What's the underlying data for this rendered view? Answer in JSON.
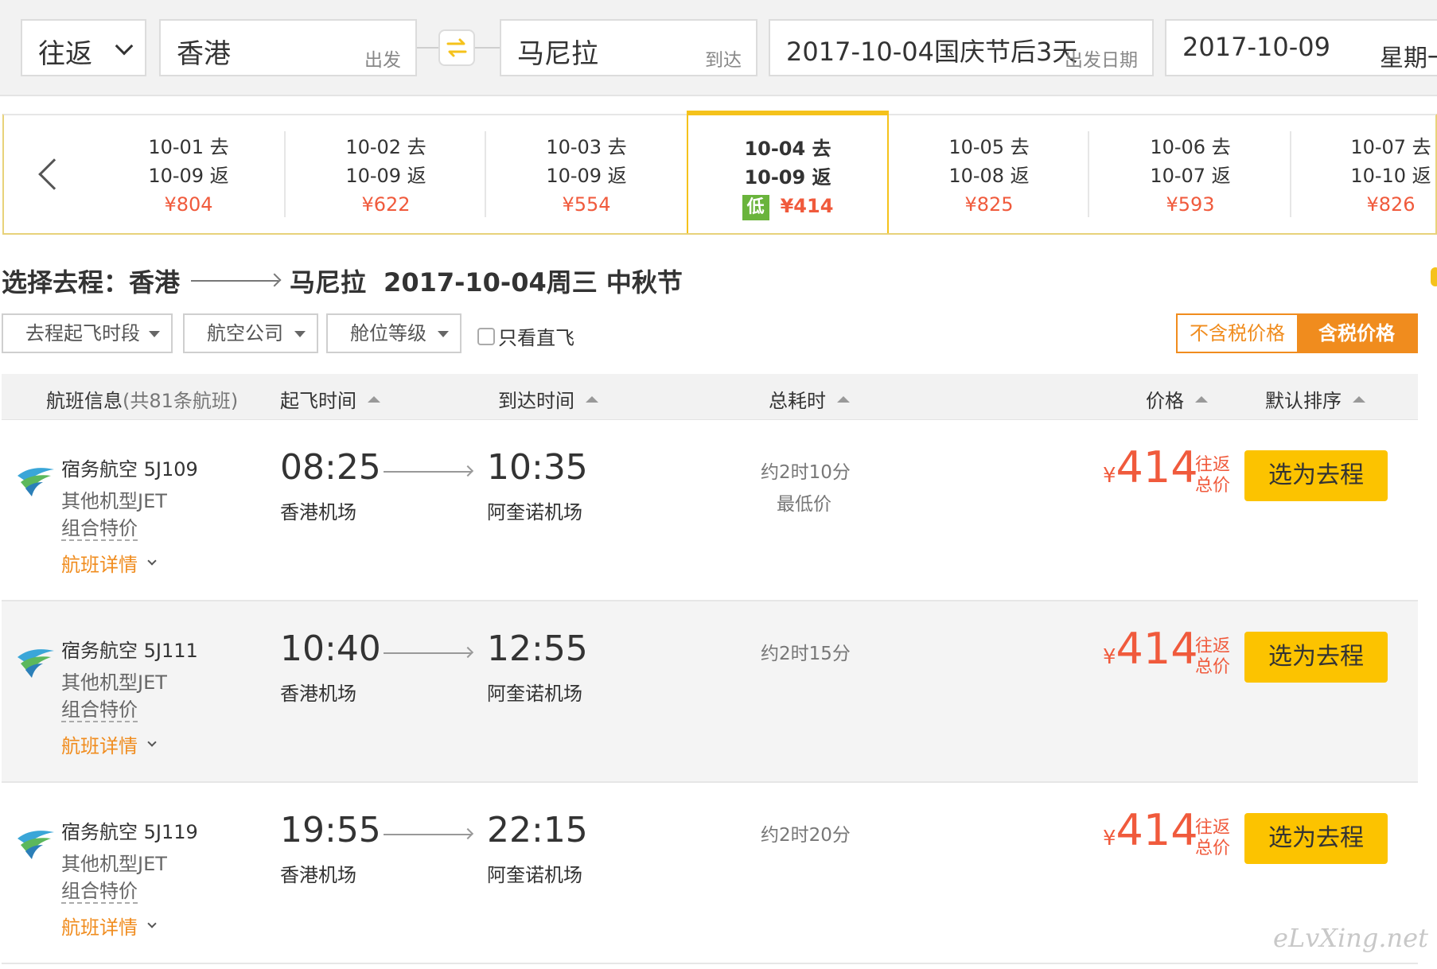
{
  "search": {
    "trip_type": "往返",
    "from_city": "香港",
    "from_hint": "出发",
    "to_city": "马尼拉",
    "to_hint": "到达",
    "depart_date": "2017-10-04国庆节后3天",
    "depart_hint": "出发日期",
    "return_date": "2017-10-09",
    "return_weekday": "星期一"
  },
  "date_strip": [
    {
      "go": "10-01 去",
      "ret": "10-09 返",
      "price": "¥804",
      "active": false
    },
    {
      "go": "10-02 去",
      "ret": "10-09 返",
      "price": "¥622",
      "active": false
    },
    {
      "go": "10-03 去",
      "ret": "10-09 返",
      "price": "¥554",
      "active": false
    },
    {
      "go": "10-04 去",
      "ret": "10-09 返",
      "price": "¥414",
      "active": true,
      "badge": "低"
    },
    {
      "go": "10-05 去",
      "ret": "10-08 返",
      "price": "¥825",
      "active": false
    },
    {
      "go": "10-06 去",
      "ret": "10-07 返",
      "price": "¥593",
      "active": false
    },
    {
      "go": "10-07 去",
      "ret": "10-10 返",
      "price": "¥826",
      "active": false
    }
  ],
  "section": {
    "label": "选择去程：",
    "from": "香港",
    "to": "马尼拉",
    "date": "2017-10-04周三 中秋节"
  },
  "filters": {
    "time": "去程起飞时段",
    "airline": "航空公司",
    "cabin": "舱位等级",
    "direct_only": "只看直飞",
    "tax_excluded": "不含税价格",
    "tax_included": "含税价格"
  },
  "table_header": {
    "info": "航班信息",
    "count": "(共81条航班)",
    "depart": "起飞时间",
    "arrive": "到达时间",
    "duration": "总耗时",
    "price": "价格",
    "default_sort": "默认排序"
  },
  "flights": [
    {
      "airline": "宿务航空 5J109",
      "model": "其他机型JET",
      "combo": "组合特价",
      "details": "航班详情",
      "dep_time": "08:25",
      "dep_airport": "香港机场",
      "arr_time": "10:35",
      "arr_airport": "阿奎诺机场",
      "duration": "约2时10分",
      "tag": "最低价",
      "yen": "¥",
      "price": "414",
      "price_note": "往返总价",
      "button": "选为去程"
    },
    {
      "airline": "宿务航空 5J111",
      "model": "其他机型JET",
      "combo": "组合特价",
      "details": "航班详情",
      "dep_time": "10:40",
      "dep_airport": "香港机场",
      "arr_time": "12:55",
      "arr_airport": "阿奎诺机场",
      "duration": "约2时15分",
      "tag": "",
      "yen": "¥",
      "price": "414",
      "price_note": "往返总价",
      "button": "选为去程"
    },
    {
      "airline": "宿务航空 5J119",
      "model": "其他机型JET",
      "combo": "组合特价",
      "details": "航班详情",
      "dep_time": "19:55",
      "dep_airport": "香港机场",
      "arr_time": "22:15",
      "arr_airport": "阿奎诺机场",
      "duration": "约2时20分",
      "tag": "",
      "yen": "¥",
      "price": "414",
      "price_note": "往返总价",
      "button": "选为去程"
    }
  ],
  "watermark": "eLvXing.net",
  "colors": {
    "accent_orange": "#f08c1e",
    "price_red": "#f05a3c",
    "button_yellow": "#fcc300",
    "low_green": "#6ab43c"
  }
}
